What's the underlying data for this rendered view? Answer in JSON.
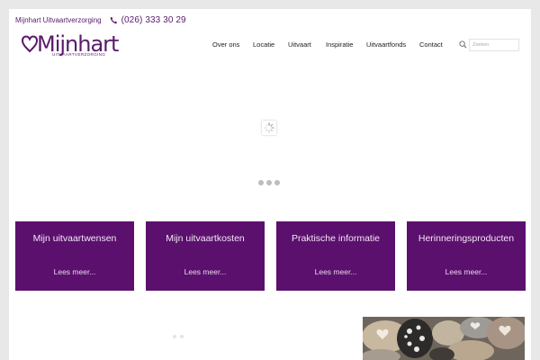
{
  "topbar": {
    "company": "Mijnhart Uitvaartverzorging",
    "phone": "(026) 333 30 29",
    "phone_icon": "phone-icon"
  },
  "logo": {
    "name": "Mijnhart",
    "subtitle": "UITVAARTVERZORGING"
  },
  "nav": {
    "items": [
      "Over ons",
      "Locatie",
      "Uitvaart",
      "Inspiratie",
      "Uitvaartfonds",
      "Contact"
    ]
  },
  "search": {
    "placeholder": "Zoeken",
    "icon": "search-icon"
  },
  "tiles": [
    {
      "title": "Mijn uitvaartwensen",
      "link": "Lees meer..."
    },
    {
      "title": "Mijn uitvaartkosten",
      "link": "Lees meer..."
    },
    {
      "title": "Praktische informatie",
      "link": "Lees meer..."
    },
    {
      "title": "Herinneringsproducten",
      "link": "Lees meer..."
    }
  ],
  "colors": {
    "brand": "#5a1a6b",
    "tile_bg": "#5c106e",
    "page_bg": "#ffffff",
    "outer_bg": "#e8e8e8"
  }
}
